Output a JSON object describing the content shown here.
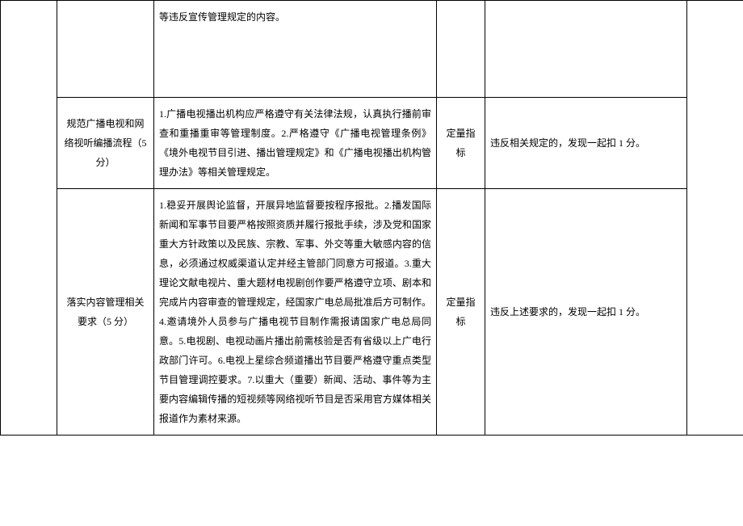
{
  "rows": [
    {
      "col2": "",
      "col3": "等违反宣传管理规定的内容。",
      "col4": "",
      "col5": ""
    },
    {
      "col2": "规范广播电视和网络视听编播流程（5 分）",
      "col3": "1.广播电视播出机构应严格遵守有关法律法规，认真执行播前审查和重播重审等管理制度。2.严格遵守《广播电视管理条例》《境外电视节目引进、播出管理规定》和《广播电视播出机构管理办法》等相关管理规定。",
      "col4": "定量指标",
      "col5": "违反相关规定的，发现一起扣 1 分。"
    },
    {
      "col2": "落实内容管理相关要求（5 分）",
      "col3": "1.稳妥开展舆论监督，开展异地监督要按程序报批。2.播发国际新闻和军事节目要严格按照资质并履行报批手续，涉及党和国家重大方针政策以及民族、宗教、军事、外交等重大敏感内容的信息，必须通过权威渠道认定并经主管部门同意方可报道。3.重大理论文献电视片、重大题材电视剧创作要严格遵守立项、剧本和完成片内容审查的管理规定，经国家广电总局批准后方可制作。4.邀请境外人员参与广播电视节目制作需报请国家广电总局同意。5.电视剧、电视动画片播出前需核验是否有省级以上广电行政部门许可。6.电视上星综合频道播出节目要严格遵守重点类型节目管理调控要求。7.以重大（重要）新闻、活动、事件等为主要内容编辑传播的短视频等网络视听节目是否采用官方媒体相关报道作为素材来源。",
      "col4": "定量指标",
      "col5": "违反上述要求的，发现一起扣 1 分。"
    }
  ]
}
